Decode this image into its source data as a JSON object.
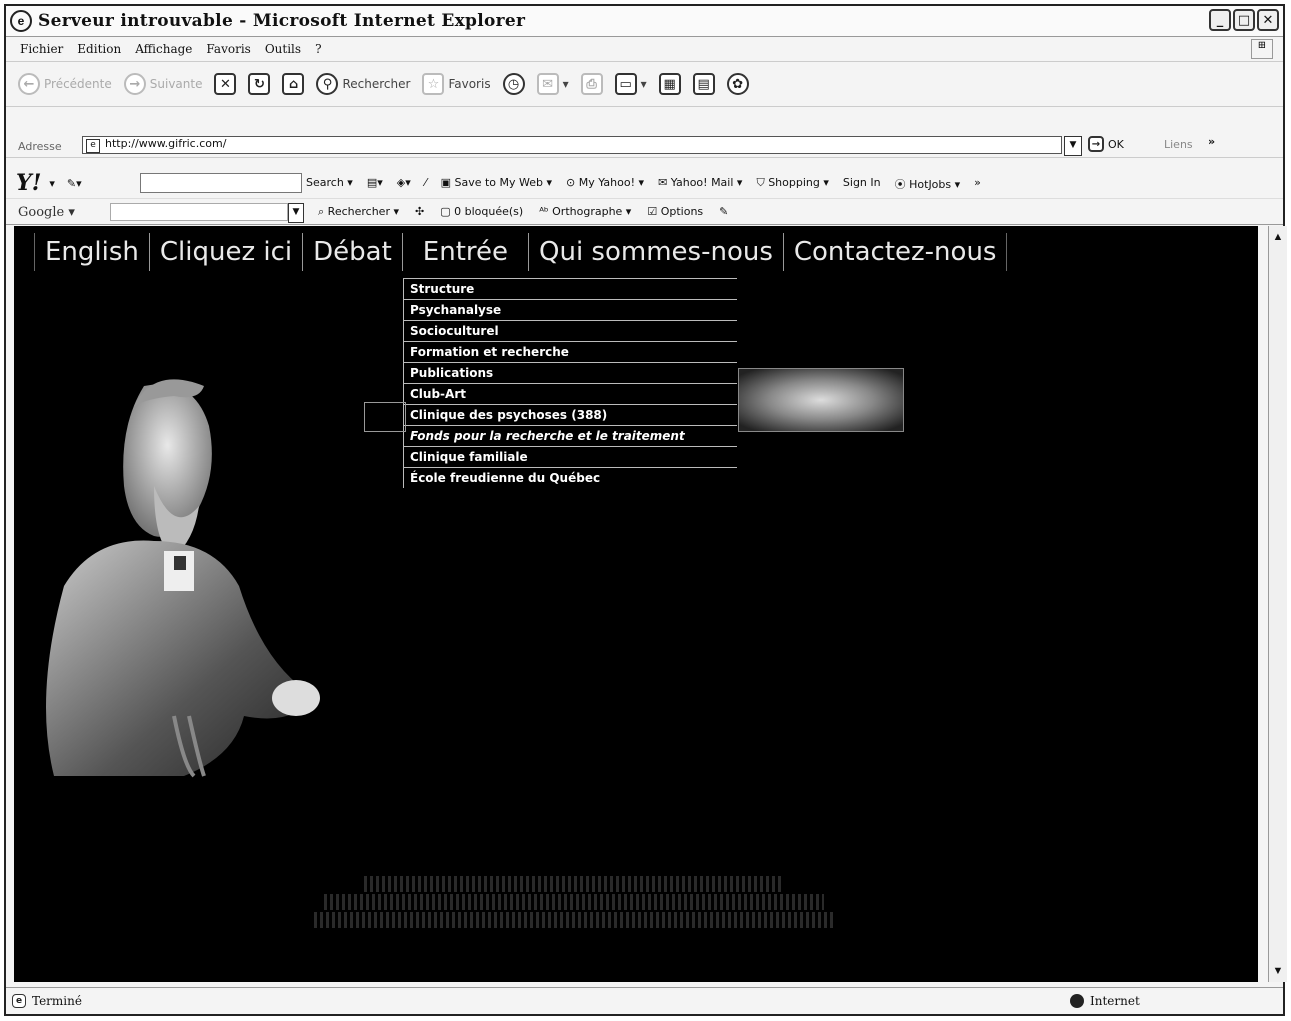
{
  "window": {
    "title": "Serveur introuvable - Microsoft Internet Explorer"
  },
  "menu": [
    "Fichier",
    "Edition",
    "Affichage",
    "Favoris",
    "Outils",
    "?"
  ],
  "toolbar": {
    "back": "Précédente",
    "forward": "Suivante",
    "search": "Rechercher",
    "favorites": "Favoris"
  },
  "address": {
    "label": "Adresse",
    "url": "http://www.gifric.com/",
    "go": "OK",
    "links": "Liens",
    "more": "»"
  },
  "yahoo": {
    "logo": "Y!",
    "items": [
      "Search",
      "Save to My Web",
      "My Yahoo!",
      "Yahoo! Mail",
      "Shopping",
      "Sign In",
      "HotJobs"
    ],
    "more": "»"
  },
  "google": {
    "logo": "Google",
    "items": [
      "Rechercher",
      "0 bloquée(s)",
      "Orthographe",
      "Options"
    ]
  },
  "site": {
    "nav": [
      "English",
      "Cliquez ici",
      "Débat",
      "Entrée",
      "Qui sommes-nous",
      "Contactez-nous"
    ],
    "dropdown": [
      "Structure",
      "Psychanalyse",
      "Socioculturel",
      "Formation et recherche",
      "Publications",
      "Club-Art",
      "Clinique des psychoses (388)",
      "Fonds pour la recherche et le traitement",
      "Clinique familiale",
      "École freudienne du Québec"
    ]
  },
  "status": {
    "left": "Terminé",
    "zone": "Internet"
  }
}
